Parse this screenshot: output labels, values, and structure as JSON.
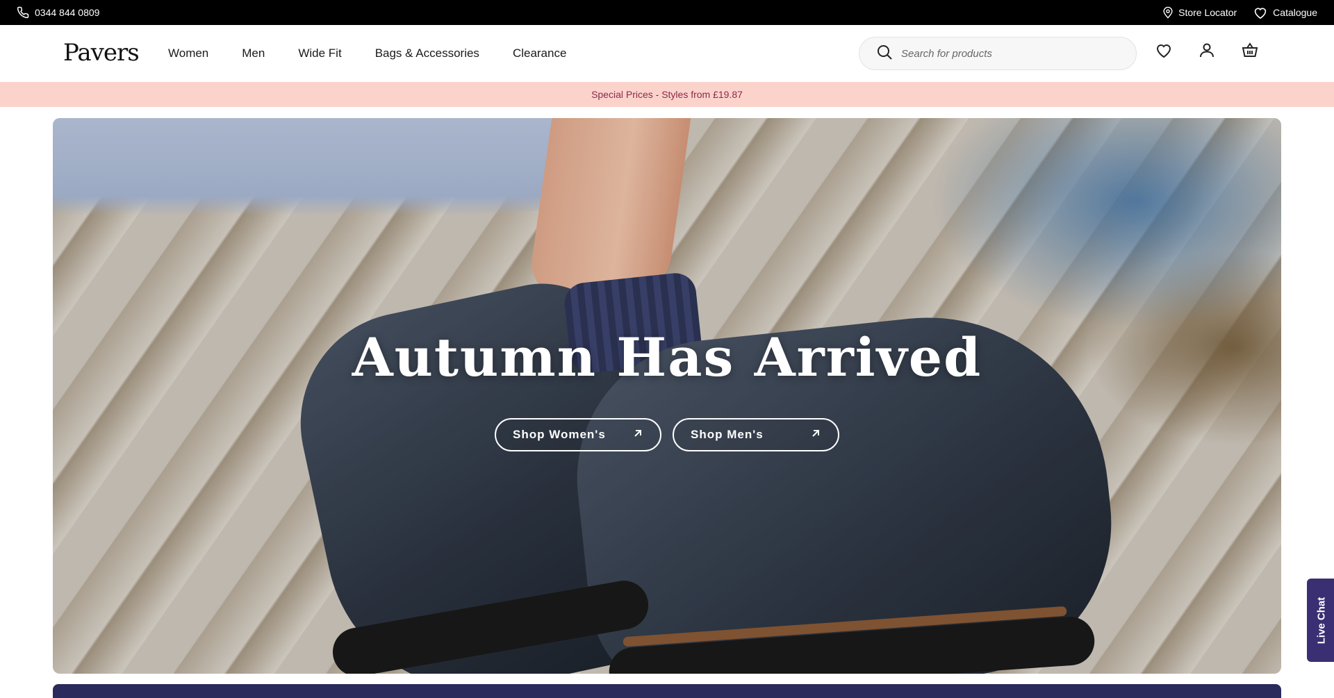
{
  "topbar": {
    "phone": "0344 844 0809",
    "store_locator": "Store Locator",
    "catalogue": "Catalogue"
  },
  "header": {
    "logo": "Pavers",
    "nav": [
      "Women",
      "Men",
      "Wide Fit",
      "Bags & Accessories",
      "Clearance"
    ],
    "search_placeholder": "Search for products"
  },
  "promo": {
    "text": "Special Prices - Styles from £19.87"
  },
  "hero": {
    "title": "Autumn Has Arrived",
    "buttons": [
      "Shop Women's",
      "Shop Men's"
    ]
  },
  "live_chat": "Live Chat",
  "colors": {
    "topbar": "#000000",
    "promo_bg": "#fbd3cb",
    "promo_text": "#8b2a4a",
    "live_chat": "#3a2f72"
  },
  "icons": [
    "phone-icon",
    "location-pin-icon",
    "heart-icon",
    "search-icon",
    "wishlist-icon",
    "account-icon",
    "basket-icon",
    "arrow-up-right-icon"
  ]
}
